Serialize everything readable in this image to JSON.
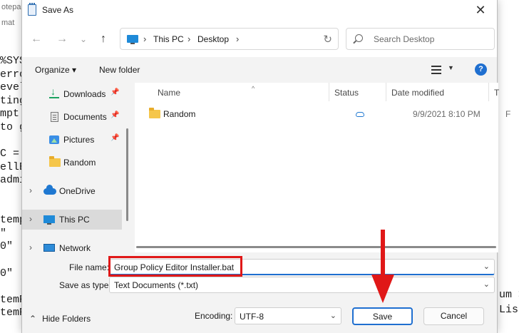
{
  "background": {
    "title_fragment": "otepa",
    "menu_fragment": "mat",
    "code_lines": [
      "%SYS",
      "erro",
      "evel",
      "ting",
      "mpt",
      "to g",
      "",
      "C =",
      "ellE",
      "admi",
      "",
      "",
      "temp",
      "\"",
      "0\"",
      "",
      "0\"",
      "",
      "temR",
      "temR"
    ],
    "right_fragments": [
      "um >",
      "List"
    ]
  },
  "dialog": {
    "title": "Save As",
    "close_glyph": "✕"
  },
  "navbar": {
    "back_glyph": "←",
    "forward_glyph": "→",
    "recent_glyph": "⌄",
    "up_glyph": "↑",
    "breadcrumb": [
      "This PC",
      "Desktop"
    ],
    "separator": "›",
    "refresh_glyph": "↻",
    "search_placeholder": "Search Desktop"
  },
  "toolbar": {
    "organize": "Organize ▾",
    "new_folder": "New folder",
    "view_caret": "▼",
    "help": "?"
  },
  "navpane": {
    "items": [
      {
        "label": "Downloads",
        "icon": "download-icon",
        "pinned": true
      },
      {
        "label": "Documents",
        "icon": "documents-icon",
        "pinned": true
      },
      {
        "label": "Pictures",
        "icon": "pictures-icon",
        "pinned": true
      },
      {
        "label": "Random",
        "icon": "folder-icon",
        "pinned": false
      },
      {
        "label": "OneDrive",
        "icon": "cloud-icon",
        "expandable": true
      },
      {
        "label": "This PC",
        "icon": "computer-icon",
        "expandable": true,
        "selected": true
      },
      {
        "label": "Network",
        "icon": "network-icon",
        "expandable": true
      }
    ],
    "chevron": "›",
    "pin_glyph": "📌"
  },
  "filelist": {
    "columns": [
      "Name",
      "Status",
      "Date modified",
      "T"
    ],
    "sort_caret": "^",
    "rows": [
      {
        "name": "Random",
        "status": "cloud",
        "date": "9/9/2021 8:10 PM",
        "type": "F"
      }
    ]
  },
  "form": {
    "filename_label": "File name:",
    "filename_value": "Group Policy Editor Installer.bat",
    "savetype_label": "Save as type:",
    "savetype_value": "Text Documents (*.txt)",
    "dropdown_caret": "⌄",
    "hide_folders": "Hide Folders",
    "hide_folders_glyph": "⌃",
    "encoding_label": "Encoding:",
    "encoding_value": "UTF-8",
    "save_button": "Save",
    "cancel_button": "Cancel"
  },
  "colors": {
    "accent": "#1f6fd0",
    "annotation": "#e01818",
    "folder": "#f5c64a"
  }
}
